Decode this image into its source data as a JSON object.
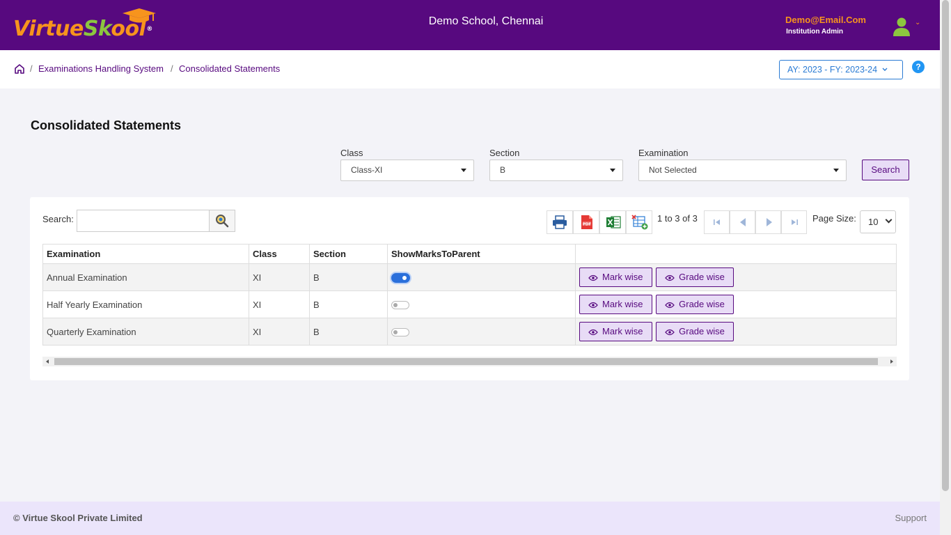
{
  "header": {
    "logo_part1": "Virtue",
    "logo_part2": "Sk",
    "logo_part3": "ool",
    "logo_reg": "®",
    "school": "Demo School, Chennai",
    "user_email": "Demo@Email.Com",
    "user_role": "Institution Admin",
    "colors": {
      "brand": "#57097f",
      "accent": "#f7941d",
      "green": "#8cc63f"
    }
  },
  "breadcrumb": {
    "items": [
      "Examinations Handling System",
      "Consolidated Statements"
    ],
    "separator": "/"
  },
  "year_selector": {
    "value": "AY: 2023 - FY: 2023-24"
  },
  "help": {
    "glyph": "?"
  },
  "page": {
    "title": "Consolidated Statements"
  },
  "filters": {
    "class": {
      "label": "Class",
      "value": "Class-XI"
    },
    "section": {
      "label": "Section",
      "value": "B"
    },
    "examination": {
      "label": "Examination",
      "value": "Not Selected"
    },
    "search_button": "Search"
  },
  "grid": {
    "search_label": "Search:",
    "search_value": "",
    "pager_text": "1 to 3 of 3",
    "page_size_label": "Page Size:",
    "page_size": "10",
    "columns": [
      "Examination",
      "Class",
      "Section",
      "ShowMarksToParent",
      ""
    ],
    "rows": [
      {
        "examination": "Annual Examination",
        "class": "XI",
        "section": "B",
        "show_marks_to_parent": true
      },
      {
        "examination": "Half Yearly Examination",
        "class": "XI",
        "section": "B",
        "show_marks_to_parent": false
      },
      {
        "examination": "Quarterly Examination",
        "class": "XI",
        "section": "B",
        "show_marks_to_parent": false
      }
    ],
    "mark_wise_label": "Mark wise",
    "grade_wise_label": "Grade wise"
  },
  "footer": {
    "copyright": "© Virtue Skool Private Limited",
    "support": "Support"
  }
}
